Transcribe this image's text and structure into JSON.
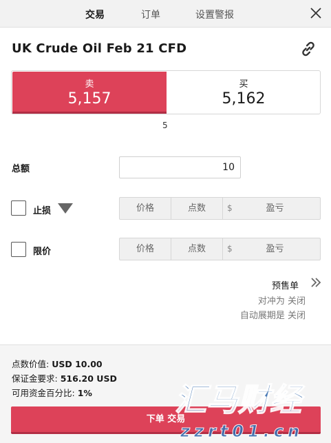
{
  "tabs": [
    {
      "label": "交易",
      "active": true
    },
    {
      "label": "订单",
      "active": false
    },
    {
      "label": "设置警报",
      "active": false
    }
  ],
  "instrument": {
    "name": "UK Crude Oil Feb 21 CFD"
  },
  "quote": {
    "sell_label": "卖",
    "sell_price": "5,157",
    "buy_label": "买",
    "buy_price": "5,162",
    "spread": "5"
  },
  "amount": {
    "label": "总额",
    "value": "10"
  },
  "stop_loss": {
    "label": "止损",
    "price": "价格",
    "points": "点数",
    "currency": "$",
    "pl": "盈亏"
  },
  "limit": {
    "label": "限价",
    "price": "价格",
    "points": "点数",
    "currency": "$",
    "pl": "盈亏"
  },
  "preorder": {
    "label": "预售单",
    "hedge": "对冲为 关闭",
    "rollover": "自动展期是 关闭"
  },
  "footer": {
    "point_value_label": "点数价值:",
    "point_value": "USD 10.00",
    "margin_label": "保证金要求:",
    "margin": "516.20 USD",
    "available_label": "可用资金百分比:",
    "available": "1%",
    "place_order": "下单 交易"
  },
  "watermark": {
    "title": "汇马财经",
    "url": "zzrt01.cn"
  },
  "colors": {
    "sell": "#dd4259",
    "sell_dark": "#b22e45",
    "watermark": "#3a6fb0"
  },
  "icons": {
    "close": "close-icon",
    "link": "link-icon",
    "dropdown": "triangle-down-icon",
    "chevron": "double-chevron-right-icon"
  }
}
